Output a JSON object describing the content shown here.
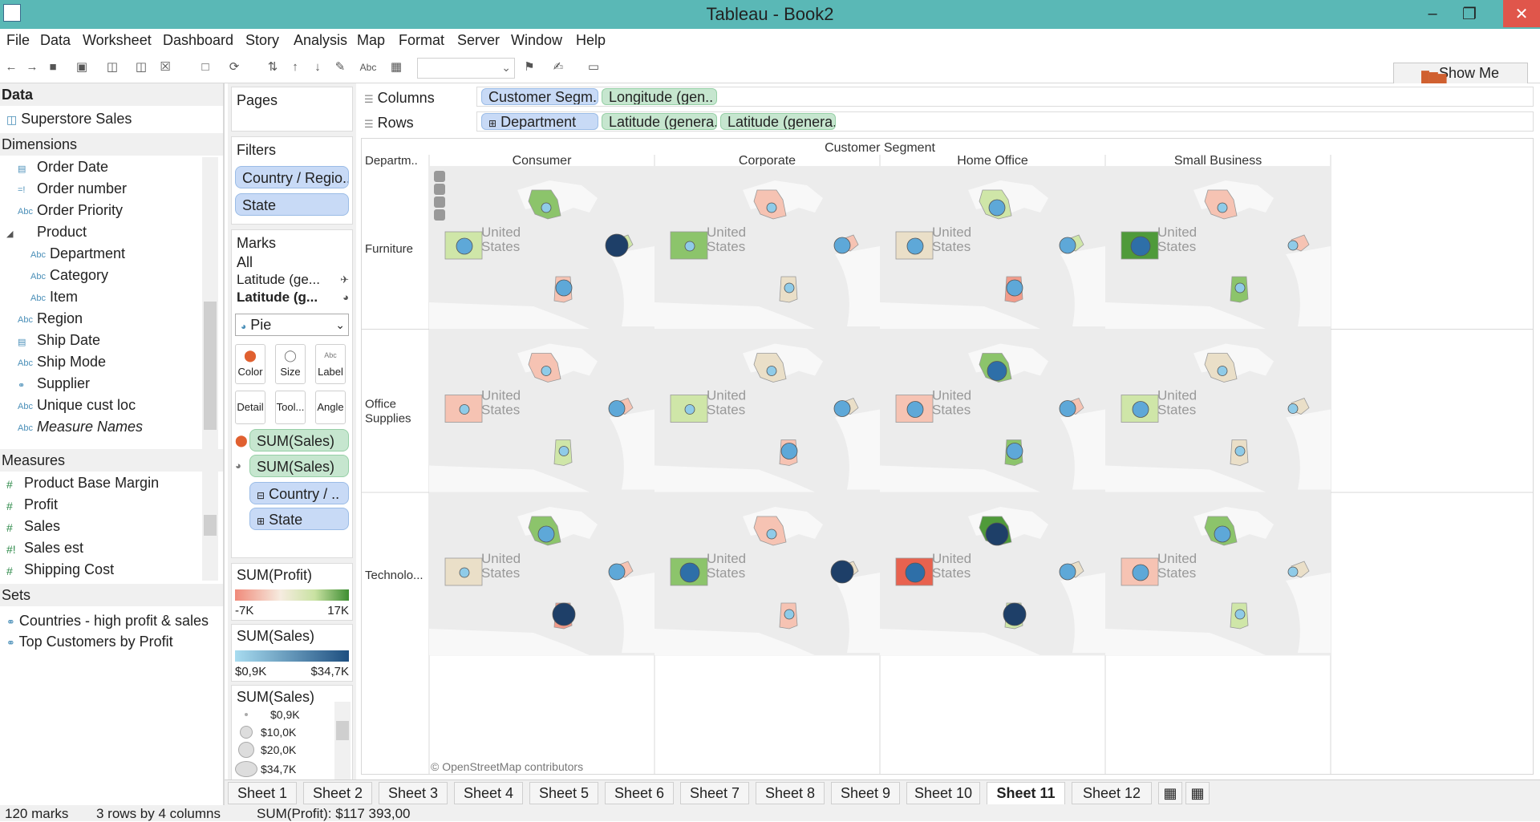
{
  "window": {
    "title": "Tableau - Book2"
  },
  "menu": [
    "File",
    "Data",
    "Worksheet",
    "Dashboard",
    "Story",
    "Analysis",
    "Map",
    "Format",
    "Server",
    "Window",
    "Help"
  ],
  "toolbar": {
    "show_me_label": "Show Me",
    "abc_label": "Abc"
  },
  "data_pane": {
    "header": "Data",
    "datasource": "Superstore Sales",
    "dimensions_header": "Dimensions",
    "dimensions": [
      {
        "name": "Order Date",
        "type": "date",
        "indent": 0
      },
      {
        "name": "Order number",
        "type": "num-str",
        "indent": 0
      },
      {
        "name": "Order Priority",
        "type": "abc",
        "indent": 0
      },
      {
        "name": "Product",
        "type": "hierarchy",
        "indent": 0
      },
      {
        "name": "Department",
        "type": "abc",
        "indent": 1
      },
      {
        "name": "Category",
        "type": "abc",
        "indent": 1
      },
      {
        "name": "Item",
        "type": "abc",
        "indent": 1
      },
      {
        "name": "Region",
        "type": "abc",
        "indent": 0
      },
      {
        "name": "Ship Date",
        "type": "date",
        "indent": 0
      },
      {
        "name": "Ship Mode",
        "type": "abc",
        "indent": 0
      },
      {
        "name": "Supplier",
        "type": "link",
        "indent": 0
      },
      {
        "name": "Unique cust loc",
        "type": "abc",
        "indent": 0
      },
      {
        "name": "Measure Names",
        "type": "abc",
        "indent": 0,
        "italic": true
      }
    ],
    "measures_header": "Measures",
    "measures": [
      {
        "name": "Product Base Margin",
        "type": "#"
      },
      {
        "name": "Profit",
        "type": "#"
      },
      {
        "name": "Sales",
        "type": "#"
      },
      {
        "name": "Sales est",
        "type": "#!"
      },
      {
        "name": "Shipping Cost",
        "type": "#"
      }
    ],
    "sets_header": "Sets",
    "sets": [
      "Countries - high profit & sales",
      "Top Customers by Profit"
    ]
  },
  "cards": {
    "pages": "Pages",
    "filters": "Filters",
    "filter_pills": [
      "Country / Regio..",
      "State"
    ],
    "marks": "Marks",
    "marks_all": "All",
    "marks_layer1": "Latitude (ge...",
    "marks_layer2": "Latitude (g...",
    "mark_type": "Pie",
    "mark_buttons": [
      "Color",
      "Size",
      "Label",
      "Detail",
      "Tool...",
      "Angle"
    ],
    "mark_pills": [
      "SUM(Sales)",
      "SUM(Sales)",
      "Country / ..",
      "State"
    ],
    "legend_profit_title": "SUM(Profit)",
    "legend_profit_min": "-7K",
    "legend_profit_max": "17K",
    "legend_sales_title": "SUM(Sales)",
    "legend_sales_min": "$0,9K",
    "legend_sales_max": "$34,7K",
    "legend_size_title": "SUM(Sales)",
    "legend_size_items": [
      "$0,9K",
      "$10,0K",
      "$20,0K",
      "$34,7K"
    ]
  },
  "shelves": {
    "columns_label": "Columns",
    "rows_label": "Rows",
    "columns": [
      "Customer Segm..",
      "Longitude (gen.."
    ],
    "rows": [
      "Department",
      "Latitude (genera..",
      "Latitude (genera.."
    ]
  },
  "view": {
    "header_top": "Customer Segment",
    "row_header_label": "Departm..",
    "columns": [
      "Consumer",
      "Corporate",
      "Home Office",
      "Small Business"
    ],
    "rows": [
      "Furniture",
      "Office Supplies",
      "Technolo..."
    ],
    "map_label_1": "United",
    "map_label_2": "States",
    "attribution": "© OpenStreetMap contributors",
    "colors": {
      "pos_strong": "#4f9a3a",
      "pos": "#8cc46b",
      "pos_light": "#cfe6a8",
      "neutral": "#eadfc8",
      "neg_light": "#f6c3b3",
      "neg": "#f19b8a",
      "neg_strong": "#e8624f",
      "sales_light": "#8fcbe8",
      "sales_mid": "#4a8fc4",
      "sales_dark": "#1e4f80"
    },
    "cells": [
      [
        {
          "states": [
            "pos_light",
            "pos",
            "pos_light",
            "neg_light"
          ],
          "bubbles": [
            1,
            0,
            3,
            1
          ]
        },
        {
          "states": [
            "pos",
            "neg_light",
            "neg_light",
            "neutral"
          ],
          "bubbles": [
            0,
            0,
            1,
            0
          ]
        },
        {
          "states": [
            "neutral",
            "pos_light",
            "pos_light",
            "neg"
          ],
          "bubbles": [
            1,
            1,
            1,
            1
          ]
        },
        {
          "states": [
            "pos_strong",
            "neg_light",
            "neg_light",
            "pos"
          ],
          "bubbles": [
            2,
            0,
            0,
            0
          ]
        }
      ],
      [
        {
          "states": [
            "neg_light",
            "neg_light",
            "neg_light",
            "pos_light"
          ],
          "bubbles": [
            0,
            0,
            1,
            0
          ]
        },
        {
          "states": [
            "pos_light",
            "neutral",
            "neutral",
            "neg_light"
          ],
          "bubbles": [
            0,
            0,
            1,
            1
          ]
        },
        {
          "states": [
            "neg_light",
            "pos",
            "neg_light",
            "pos"
          ],
          "bubbles": [
            1,
            2,
            1,
            1
          ]
        },
        {
          "states": [
            "pos_light",
            "neutral",
            "neutral",
            "neutral"
          ],
          "bubbles": [
            1,
            0,
            0,
            0
          ]
        }
      ],
      [
        {
          "states": [
            "neutral",
            "pos",
            "neg_light",
            "neg"
          ],
          "bubbles": [
            0,
            1,
            1,
            3
          ]
        },
        {
          "states": [
            "pos",
            "neg_light",
            "neutral",
            "neg_light"
          ],
          "bubbles": [
            2,
            0,
            3,
            0
          ]
        },
        {
          "states": [
            "neg_strong",
            "pos_strong",
            "neutral",
            "pos_light"
          ],
          "bubbles": [
            2,
            3,
            1,
            3
          ]
        },
        {
          "states": [
            "neg_light",
            "pos",
            "neutral",
            "pos_light"
          ],
          "bubbles": [
            1,
            1,
            0,
            0
          ]
        }
      ]
    ]
  },
  "tabs": [
    "Sheet 1",
    "Sheet 2",
    "Sheet 3",
    "Sheet 4",
    "Sheet 5",
    "Sheet 6",
    "Sheet 7",
    "Sheet 8",
    "Sheet 9",
    "Sheet 10",
    "Sheet 11",
    "Sheet 12"
  ],
  "active_tab": "Sheet 11",
  "status": {
    "marks": "120 marks",
    "dims": "3 rows by 4 columns",
    "sum": "SUM(Profit): $117 393,00"
  }
}
